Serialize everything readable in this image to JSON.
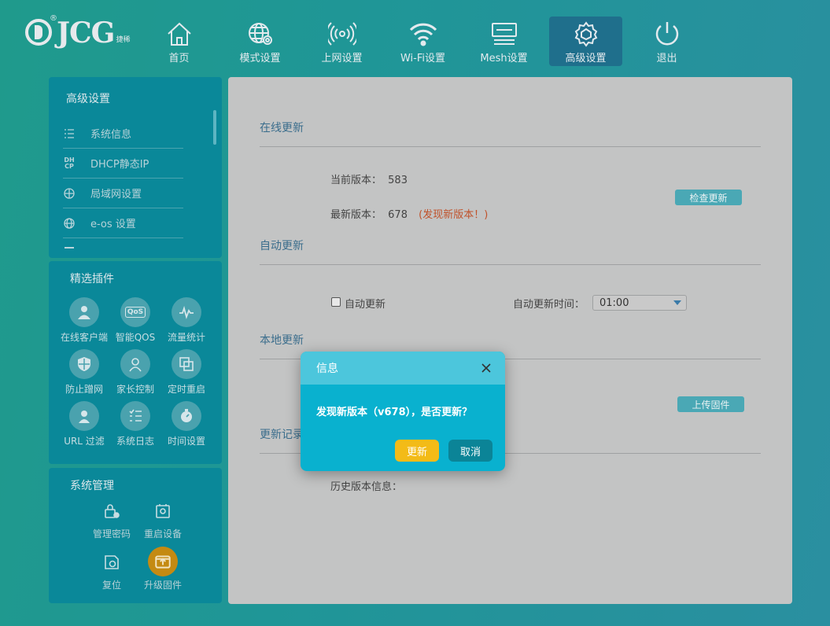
{
  "brand": {
    "name": "JCG",
    "sub": "捷稀",
    "reg": "®"
  },
  "nav": [
    {
      "label": "首页",
      "icon": "home-icon"
    },
    {
      "label": "模式设置",
      "icon": "globe-gear-icon"
    },
    {
      "label": "上网设置",
      "icon": "broadcast-icon"
    },
    {
      "label": "Wi-Fi设置",
      "icon": "wifi-icon"
    },
    {
      "label": "Mesh设置",
      "icon": "mesh-icon"
    },
    {
      "label": "高级设置",
      "icon": "gear-icon",
      "active": true
    },
    {
      "label": "退出",
      "icon": "power-icon"
    }
  ],
  "advanced_panel": {
    "title": "高级设置",
    "items": [
      {
        "label": "系统信息",
        "icon": "list-icon"
      },
      {
        "label": "DHCP静态IP",
        "icon": "dhcp-icon"
      },
      {
        "label": "局域网设置",
        "icon": "lan-globe-icon"
      },
      {
        "label": "e-os 设置",
        "icon": "globe-icon"
      }
    ]
  },
  "plugins_panel": {
    "title": "精选插件",
    "items": [
      {
        "label": "在线客户端",
        "icon": "user-icon"
      },
      {
        "label": "智能QOS",
        "icon": "qos-icon"
      },
      {
        "label": "流量统计",
        "icon": "pulse-icon"
      },
      {
        "label": "防止蹭网",
        "icon": "shield-icon"
      },
      {
        "label": "家长控制",
        "icon": "parent-icon"
      },
      {
        "label": "定时重启",
        "icon": "windows-icon"
      },
      {
        "label": "URL 过滤",
        "icon": "url-filter-icon"
      },
      {
        "label": "系统日志",
        "icon": "log-icon"
      },
      {
        "label": "时间设置",
        "icon": "stopwatch-icon"
      }
    ]
  },
  "system_panel": {
    "title": "系统管理",
    "items": [
      {
        "label": "管理密码",
        "icon": "lock-gear-icon"
      },
      {
        "label": "重启设备",
        "icon": "reboot-icon"
      },
      {
        "label": "复位",
        "icon": "reset-icon"
      },
      {
        "label": "升级固件",
        "icon": "upload-icon",
        "active": true
      }
    ]
  },
  "main": {
    "online_update": {
      "title": "在线更新",
      "current_label": "当前版本：",
      "current_value": "583",
      "latest_label": "最新版本：",
      "latest_value": "678",
      "latest_note": "(发现新版本！)",
      "check_button": "检查更新"
    },
    "auto_update": {
      "title": "自动更新",
      "checkbox_label": "自动更新",
      "time_label": "自动更新时间：",
      "time_value": "01:00"
    },
    "local_update": {
      "title": "本地更新",
      "upload_button": "上传固件"
    },
    "update_log": {
      "title": "更新记录",
      "history_label": "历史版本信息："
    }
  },
  "modal": {
    "title": "信息",
    "message": "发现新版本（v678），是否更新？",
    "ok": "更新",
    "cancel": "取消"
  },
  "colors": {
    "accent": "#09b1cf",
    "ok_button": "#f3bb17",
    "nav_active": "#1f6f8c",
    "panel": "#0a8899"
  }
}
